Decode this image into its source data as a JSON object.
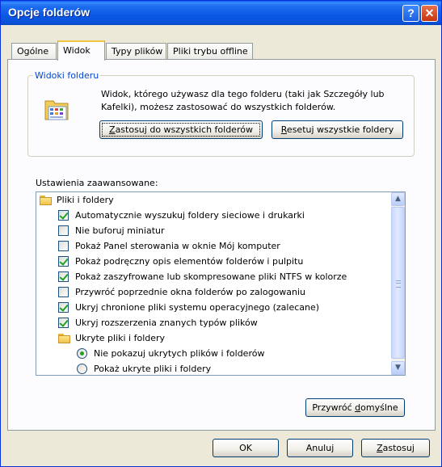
{
  "window": {
    "title": "Opcje folderów"
  },
  "titlebar": {
    "help_glyph": "?",
    "close_glyph": "✕"
  },
  "tabs": [
    {
      "label": "Ogólne"
    },
    {
      "label": "Widok"
    },
    {
      "label": "Typy plików"
    },
    {
      "label": "Pliki trybu offline"
    }
  ],
  "folder_views": {
    "group_label": "Widoki folderu",
    "description": "Widok, którego używasz dla tego folderu (taki jak Szczegóły lub Kafelki), możesz zastosować do wszystkich folderów.",
    "apply_button": {
      "pre": "",
      "key": "Z",
      "post": "astosuj do wszystkich folderów"
    },
    "reset_button": {
      "pre": "",
      "key": "R",
      "post": "esetuj wszystkie foldery"
    }
  },
  "advanced": {
    "label": "Ustawienia zaawansowane:",
    "items": [
      {
        "kind": "folder",
        "label": "Pliki i foldery"
      },
      {
        "kind": "checkbox",
        "checked": true,
        "label": "Automatycznie wyszukuj foldery sieciowe i drukarki"
      },
      {
        "kind": "checkbox",
        "checked": false,
        "label": "Nie buforuj miniatur"
      },
      {
        "kind": "checkbox",
        "checked": false,
        "label": "Pokaż Panel sterowania w oknie Mój komputer"
      },
      {
        "kind": "checkbox",
        "checked": true,
        "label": "Pokaż podręczny opis elementów folderów i pulpitu"
      },
      {
        "kind": "checkbox",
        "checked": true,
        "label": "Pokaż zaszyfrowane lub skompresowane pliki NTFS w kolorze"
      },
      {
        "kind": "checkbox",
        "checked": false,
        "label": "Przywróć poprzednie okna folderów po zalogowaniu"
      },
      {
        "kind": "checkbox",
        "checked": true,
        "label": "Ukryj chronione pliki systemu operacyjnego (zalecane)"
      },
      {
        "kind": "checkbox",
        "checked": true,
        "label": "Ukryj rozszerzenia znanych typów plików"
      },
      {
        "kind": "folder",
        "label": "Ukryte pliki i foldery"
      },
      {
        "kind": "radio",
        "checked": true,
        "label": "Nie pokazuj ukrytych plików i folderów"
      },
      {
        "kind": "radio",
        "checked": false,
        "label": "Pokaż ukryte pliki i foldery"
      }
    ]
  },
  "restore_defaults": {
    "pre": "Przywróć ",
    "key": "d",
    "post": "omyślne"
  },
  "footer": {
    "ok": "OK",
    "cancel": "Anuluj",
    "apply": {
      "pre": "",
      "key": "Z",
      "post": "astosuj"
    }
  },
  "scrollbar": {
    "up_glyph": "▲",
    "down_glyph": "▼"
  }
}
